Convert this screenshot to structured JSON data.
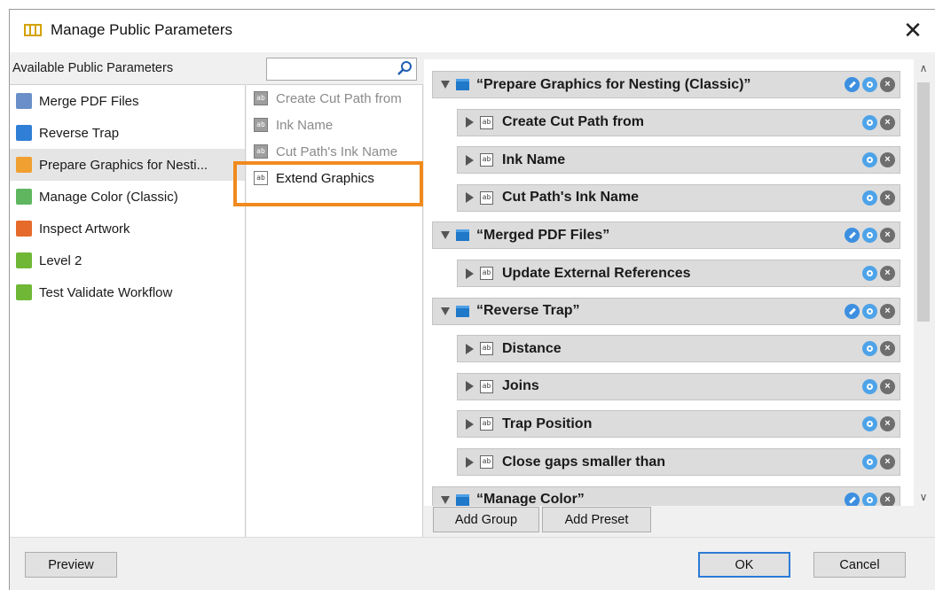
{
  "window": {
    "title": "Manage Public Parameters",
    "close_glyph": "✕"
  },
  "left": {
    "header": "Available Public Parameters",
    "items": [
      {
        "label": "Merge PDF Files",
        "icon": "merge-pdf-icon",
        "color": "#6a8fc8"
      },
      {
        "label": "Reverse Trap",
        "icon": "reverse-trap-icon",
        "color": "#2f7fd6"
      },
      {
        "label": "Prepare Graphics for Nesti...",
        "icon": "prepare-graphics-icon",
        "color": "#f0a030",
        "selected": true
      },
      {
        "label": "Manage Color (Classic)",
        "icon": "manage-color-icon",
        "color": "#5fb65f"
      },
      {
        "label": "Inspect Artwork",
        "icon": "inspect-artwork-icon",
        "color": "#e66a2a"
      },
      {
        "label": "Level 2",
        "icon": "level-icon",
        "color": "#6fb836"
      },
      {
        "label": "Test Validate Workflow",
        "icon": "workflow-icon",
        "color": "#6fb836"
      }
    ]
  },
  "search": {
    "placeholder": "",
    "icon": "search-icon"
  },
  "middle": {
    "items": [
      {
        "label": "Create Cut Path from",
        "active": false
      },
      {
        "label": "Ink Name",
        "active": false
      },
      {
        "label": "Cut Path's Ink Name",
        "active": false
      },
      {
        "label": "Extend Graphics",
        "active": true
      }
    ],
    "ab_glyph": "ab"
  },
  "tree": {
    "rows": [
      {
        "kind": "group",
        "label": "“Prepare Graphics for Nesting (Classic)”"
      },
      {
        "kind": "param",
        "label": "Create Cut Path from"
      },
      {
        "kind": "param",
        "label": "Ink Name"
      },
      {
        "kind": "param",
        "label": "Cut Path's Ink Name"
      },
      {
        "kind": "group",
        "label": "“Merged PDF Files”"
      },
      {
        "kind": "param",
        "label": "Update External References"
      },
      {
        "kind": "group",
        "label": "“Reverse Trap”"
      },
      {
        "kind": "param",
        "label": "Distance"
      },
      {
        "kind": "param",
        "label": "Joins"
      },
      {
        "kind": "param",
        "label": "Trap Position"
      },
      {
        "kind": "param",
        "label": "Close gaps smaller than"
      },
      {
        "kind": "group",
        "label": "“Manage Color”"
      }
    ]
  },
  "buttons": {
    "add_group": "Add Group",
    "add_preset": "Add Preset",
    "preview": "Preview",
    "ok": "OK",
    "cancel": "Cancel"
  },
  "colors": {
    "highlight": "#f08a1e",
    "accent": "#1f78c8"
  }
}
